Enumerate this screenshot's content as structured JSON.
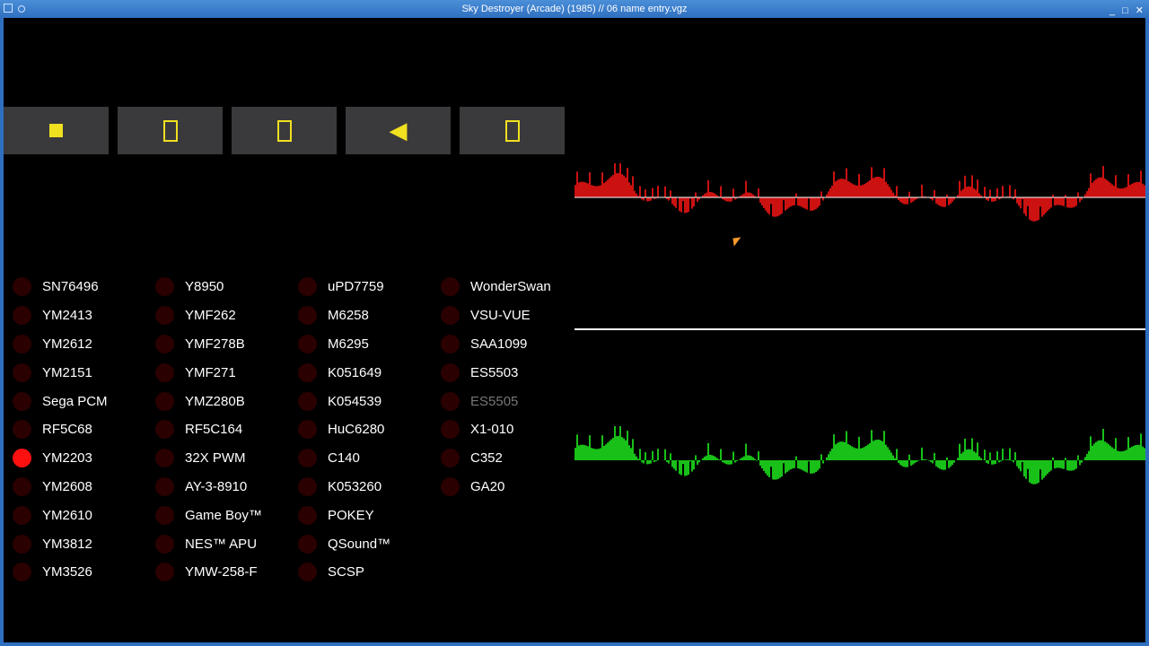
{
  "window": {
    "title": "Sky Destroyer (Arcade) (1985) // 06 name entry.vgz",
    "controls": [
      "_",
      "□",
      "✕"
    ]
  },
  "transport": {
    "buttons": [
      {
        "name": "stop-button",
        "icon": "stop-icon"
      },
      {
        "name": "placeholder-button-1",
        "icon": "missing-glyph-icon"
      },
      {
        "name": "placeholder-button-2",
        "icon": "missing-glyph-icon"
      },
      {
        "name": "previous-button",
        "icon": "left-triangle-icon",
        "glyph": "◀"
      },
      {
        "name": "placeholder-button-3",
        "icon": "missing-glyph-icon"
      }
    ],
    "accent": "#f0e020",
    "background": "#3a3a3c"
  },
  "chips": {
    "columns": [
      [
        "SN76496",
        "YM2413",
        "YM2612",
        "YM2151",
        "Sega PCM",
        "RF5C68",
        "YM2203",
        "YM2608",
        "YM2610",
        "YM3812",
        "YM3526"
      ],
      [
        "Y8950",
        "YMF262",
        "YMF278B",
        "YMF271",
        "YMZ280B",
        "RF5C164",
        "32X PWM",
        "AY-3-8910",
        "Game Boy™",
        "NES™ APU",
        "YMW-258-F"
      ],
      [
        "uPD7759",
        "M6258",
        "M6295",
        "K051649",
        "K054539",
        "HuC6280",
        "C140",
        "K053260",
        "POKEY",
        "QSound™",
        "SCSP"
      ],
      [
        "WonderSwan",
        "VSU-VUE",
        "SAA1099",
        "ES5503",
        "ES5505",
        "X1-010",
        "C352",
        "GA20"
      ]
    ],
    "active": [
      "YM2203"
    ],
    "dimmed": [
      "ES5505"
    ],
    "active_color": "#ff1010",
    "inactive_color": "#2a0000"
  },
  "oscilloscope": {
    "channels": [
      {
        "color": "#cc1111"
      },
      {
        "color": "#18c018"
      }
    ],
    "divider_color": "#ffffff"
  }
}
